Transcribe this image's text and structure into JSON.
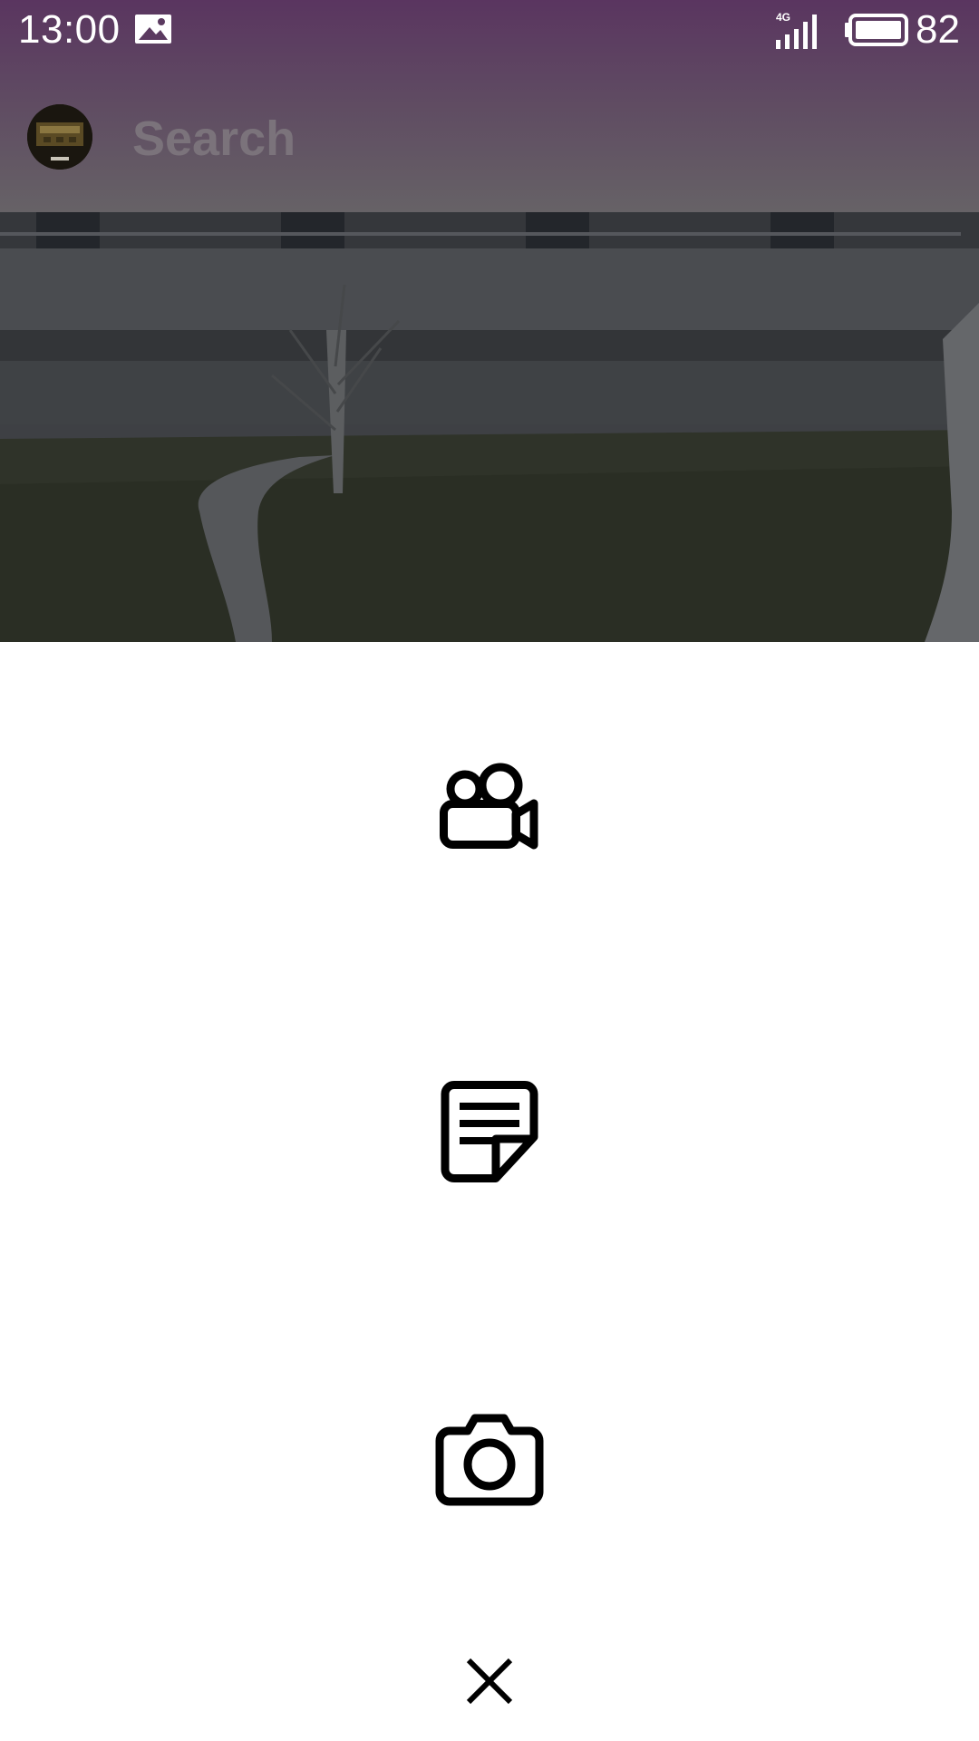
{
  "status_bar": {
    "time": "13:00",
    "network": "4G",
    "battery": "82",
    "icons": [
      "gallery-icon",
      "signal-icon",
      "battery-icon"
    ]
  },
  "header": {
    "search_placeholder": "Search",
    "avatar": "avatar"
  },
  "action_sheet": {
    "items": [
      {
        "icon": "video-camera-icon",
        "action": "record-video"
      },
      {
        "icon": "note-icon",
        "action": "write-note"
      },
      {
        "icon": "camera-icon",
        "action": "take-photo"
      },
      {
        "icon": "close-icon",
        "action": "close"
      }
    ]
  },
  "colors": {
    "header_top": "#5a3560",
    "header_bottom": "#666266",
    "sheet_background": "#ffffff",
    "icon": "#000000"
  }
}
